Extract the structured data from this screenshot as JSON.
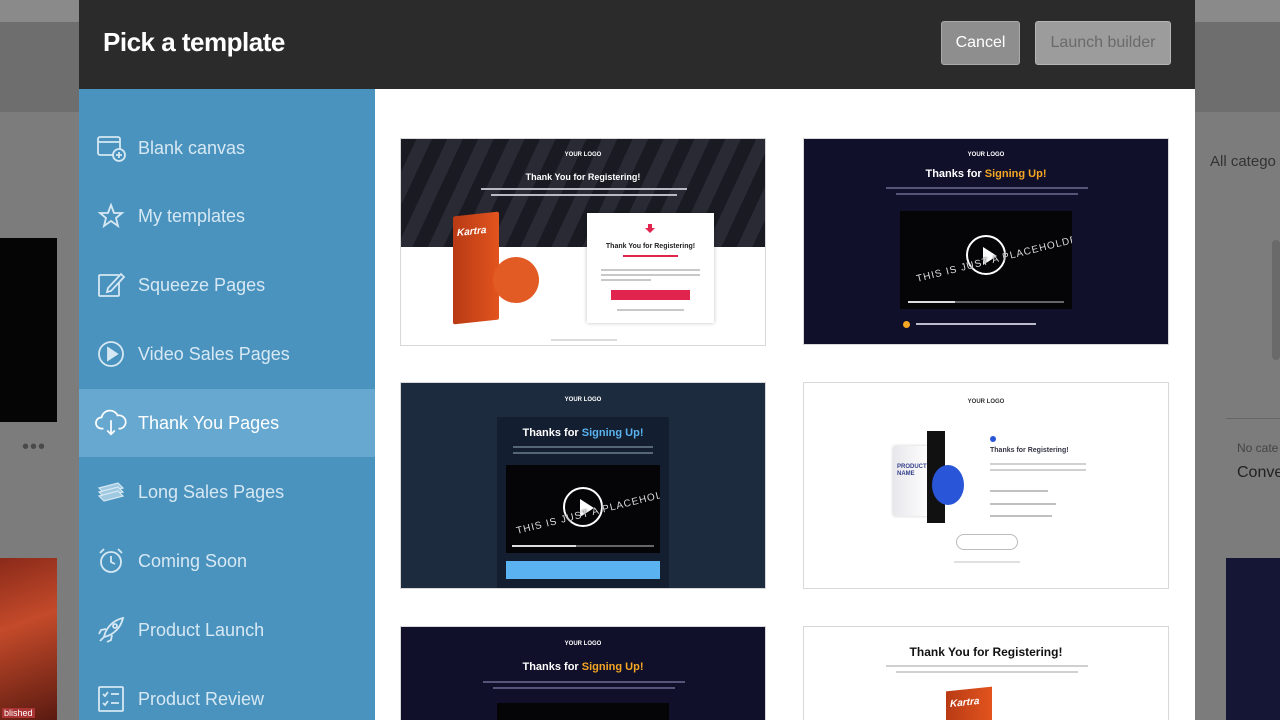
{
  "modal": {
    "title": "Pick a template",
    "cancel_label": "Cancel",
    "launch_label": "Launch builder"
  },
  "sidebar": {
    "items": [
      {
        "label": "Blank canvas",
        "icon": "blank-canvas-icon"
      },
      {
        "label": "My templates",
        "icon": "star-icon"
      },
      {
        "label": "Squeeze Pages",
        "icon": "edit-icon"
      },
      {
        "label": "Video Sales Pages",
        "icon": "play-circle-icon"
      },
      {
        "label": "Thank You Pages",
        "icon": "cloud-download-icon",
        "active": true
      },
      {
        "label": "Long Sales Pages",
        "icon": "cash-icon"
      },
      {
        "label": "Coming Soon",
        "icon": "alarm-clock-icon"
      },
      {
        "label": "Product Launch",
        "icon": "rocket-icon"
      },
      {
        "label": "Product Review",
        "icon": "checklist-icon"
      }
    ]
  },
  "templates": {
    "t1": {
      "logo": "YOUR LOGO",
      "heading": "Thank You for Registering!",
      "panel_heading": "Thank You for Registering!",
      "brand": "Kartra"
    },
    "t2": {
      "logo": "YOUR LOGO",
      "heading_a": "Thanks for ",
      "heading_b": "Signing Up!",
      "placeholder": "THIS IS JUST A PLACEHOLDER"
    },
    "t3": {
      "logo": "YOUR LOGO",
      "heading_a": "Thanks for ",
      "heading_b": "Signing Up!",
      "placeholder": "THIS IS JUST A PLACEHOLDER"
    },
    "t4": {
      "logo": "YOUR LOGO",
      "heading": "Thanks for Registering!",
      "product": "PRODUCT NAME"
    },
    "t5": {
      "logo": "YOUR LOGO",
      "heading_a": "Thanks for ",
      "heading_b": "Signing Up!"
    },
    "t6": {
      "heading": "Thank You for Registering!",
      "brand": "Kartra"
    }
  },
  "background": {
    "right_text_1": "All catego",
    "right_text_2": "No cate",
    "right_text_3": "Conve",
    "left_dots": "•••",
    "left_tag": "blished"
  },
  "colors": {
    "header_bg": "#2b2b2b",
    "sidebar_bg": "#4b93bf",
    "sidebar_active_bg": "#67a8d0",
    "accent_orange": "#f5a623",
    "accent_blue": "#5ab3f0"
  }
}
